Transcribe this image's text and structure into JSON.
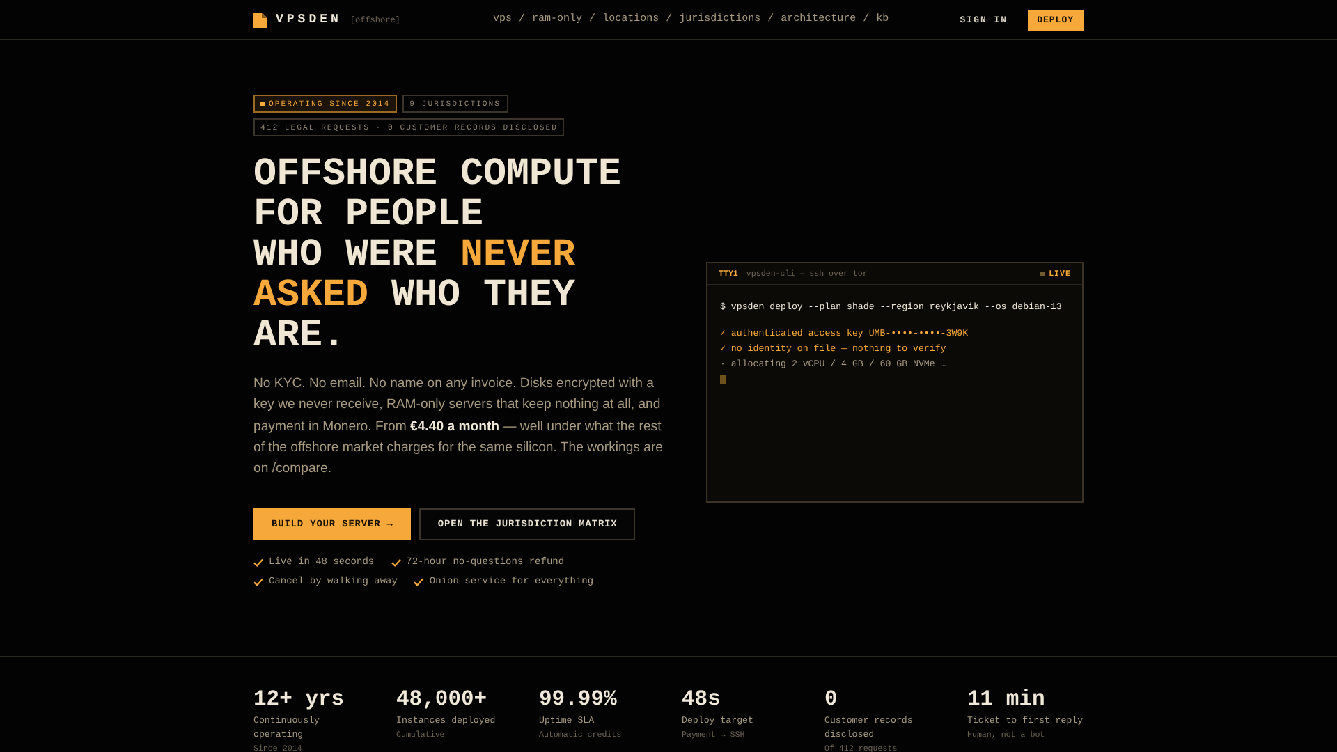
{
  "header": {
    "brand": "VPSDEN",
    "brand_tag": "[offshore]",
    "nav": [
      "vps",
      "/",
      "ram-only",
      "/",
      "locations",
      "/",
      "jurisdictions",
      "/",
      "architecture",
      "/",
      "kb"
    ],
    "sign_in": "SIGN IN",
    "deploy": "DEPLOY"
  },
  "badges": [
    {
      "text": "OPERATING SINCE 2014",
      "kind": "accent"
    },
    {
      "text": "9 JURISDICTIONS",
      "kind": "plain"
    },
    {
      "text": "412 LEGAL REQUESTS · 0 CUSTOMER RECORDS DISCLOSED",
      "kind": "plain"
    }
  ],
  "headline": [
    {
      "parts": [
        {
          "text": "OFFSHORE COMPUTE",
          "accent": false
        }
      ]
    },
    {
      "parts": [
        {
          "text": "FOR PEOPLE",
          "accent": false
        }
      ]
    },
    {
      "parts": [
        {
          "text": "WHO WERE ",
          "accent": false
        },
        {
          "text": "NEVER",
          "accent": true
        }
      ]
    },
    {
      "parts": [
        {
          "text": "ASKED",
          "accent": true
        },
        {
          "text": " WHO THEY",
          "accent": false
        }
      ]
    },
    {
      "parts": [
        {
          "text": "ARE.",
          "accent": false
        }
      ]
    }
  ],
  "intro": "No KYC. No email. No name on any invoice. Disks encrypted with a key we never receive, RAM-only servers that keep nothing at all, and payment in Monero. From **€4.40 a month** — well under what the rest of the offshore market charges for the same silicon. The workings are on /compare.",
  "buttons": [
    {
      "label": "BUILD YOUR SERVER →",
      "kind": "primary"
    },
    {
      "label": "OPEN THE JURISDICTION MATRIX",
      "kind": "secondary"
    }
  ],
  "checks": [
    [
      "Live in 48 seconds",
      "72-hour no-questions refund"
    ],
    [
      "Cancel by walking away",
      "Onion service for everything"
    ]
  ],
  "terminal": {
    "tty": "TTY1",
    "subtitle": "vpsden-cli — ssh over tor",
    "status": "LIVE",
    "lines": [
      {
        "kind": "command",
        "text": "$ vpsden deploy --plan shade --region reykjavik --os debian-13"
      },
      {
        "kind": "ok",
        "text": "✓ authenticated access key UMB-••••-••••-3W9K"
      },
      {
        "kind": "ok",
        "text": "✓ no identity on file — nothing to verify"
      },
      {
        "kind": "pending",
        "text": "· allocating 2 vCPU / 4 GB / 60 GB NVMe …"
      },
      {
        "kind": "cursor"
      }
    ]
  },
  "stats": [
    {
      "value": "12+ yrs",
      "label": "Continuously operating",
      "note": "Since 2014"
    },
    {
      "value": "48,000+",
      "label": "Instances deployed",
      "note": "Cumulative"
    },
    {
      "value": "99.99%",
      "label": "Uptime SLA",
      "note": "Automatic credits"
    },
    {
      "value": "48s",
      "label": "Deploy target",
      "note": "Payment → SSH"
    },
    {
      "value": "0",
      "label": "Customer records disclosed",
      "note": "Of 412 requests"
    },
    {
      "value": "11 min",
      "label": "Ticket to first reply",
      "note": "Human, not a bot"
    }
  ]
}
